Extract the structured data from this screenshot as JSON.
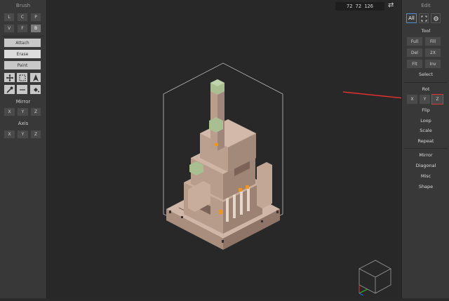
{
  "brush": {
    "title": "Brush",
    "mode_buttons": [
      "L",
      "C",
      "P",
      "V",
      "F",
      "B"
    ],
    "actions": [
      "Attach",
      "Erase",
      "Paint"
    ],
    "mirror": {
      "title": "Mirror",
      "axes": [
        "X",
        "Y",
        "Z"
      ]
    },
    "axis": {
      "title": "Axis",
      "axes": [
        "X",
        "Y",
        "Z"
      ]
    }
  },
  "status": {
    "coordinates": "72 72 126",
    "swap_icon": "⇄"
  },
  "edit": {
    "title": "Edit",
    "tab_all": "All",
    "tool_title": "Tool",
    "tools": [
      "Full",
      "Fill",
      "Del",
      "2X",
      "Flt",
      "Inv"
    ],
    "select": "Select",
    "rot_title": "Rot",
    "rot_axes": [
      "X",
      "Y",
      "Z"
    ],
    "transforms": [
      "Flip",
      "Loop",
      "Scale",
      "Repeat"
    ],
    "generators": [
      "Mirror",
      "Diagonal",
      "Misc",
      "Shape"
    ]
  }
}
